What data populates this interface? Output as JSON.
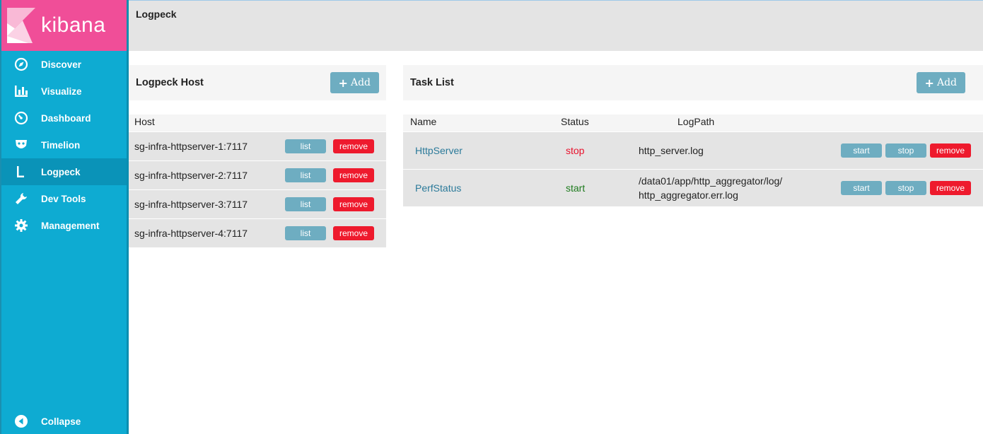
{
  "app": {
    "logo_text": "kibana",
    "page_title": "Logpeck"
  },
  "sidebar": {
    "items": [
      {
        "label": "Discover",
        "icon": "compass-icon"
      },
      {
        "label": "Visualize",
        "icon": "bar-chart-icon"
      },
      {
        "label": "Dashboard",
        "icon": "gauge-icon"
      },
      {
        "label": "Timelion",
        "icon": "mask-icon"
      },
      {
        "label": "Logpeck",
        "icon": "l-letter-icon"
      },
      {
        "label": "Dev Tools",
        "icon": "wrench-icon"
      },
      {
        "label": "Management",
        "icon": "gear-icon"
      }
    ],
    "collapse_label": "Collapse"
  },
  "hosts_panel": {
    "title": "Logpeck Host",
    "add_label": "Add",
    "column_header": "Host",
    "rows": [
      {
        "host": "sg-infra-httpserver-1:7117",
        "list_label": "list",
        "remove_label": "remove"
      },
      {
        "host": "sg-infra-httpserver-2:7117",
        "list_label": "list",
        "remove_label": "remove"
      },
      {
        "host": "sg-infra-httpserver-3:7117",
        "list_label": "list",
        "remove_label": "remove"
      },
      {
        "host": "sg-infra-httpserver-4:7117",
        "list_label": "list",
        "remove_label": "remove"
      }
    ]
  },
  "task_panel": {
    "title": "Task List",
    "add_label": "Add",
    "columns": {
      "name": "Name",
      "status": "Status",
      "logpath": "LogPath"
    },
    "rows": [
      {
        "name": "HttpServer",
        "status": "stop",
        "status_color": "#e8102b",
        "logpath_line1": "http_server.log",
        "logpath_line2": "",
        "start_label": "start",
        "stop_label": "stop",
        "remove_label": "remove"
      },
      {
        "name": "PerfStatus",
        "status": "start",
        "status_color": "#1d7a1d",
        "logpath_line1": "/data01/app/http_aggregator/log/",
        "logpath_line2": "http_aggregator.err.log",
        "start_label": "start",
        "stop_label": "stop",
        "remove_label": "remove"
      }
    ]
  },
  "colors": {
    "sidebar": "#0eabd2",
    "logo": "#f04e98",
    "button": "#6eadc1",
    "danger": "#ee1a2d"
  }
}
